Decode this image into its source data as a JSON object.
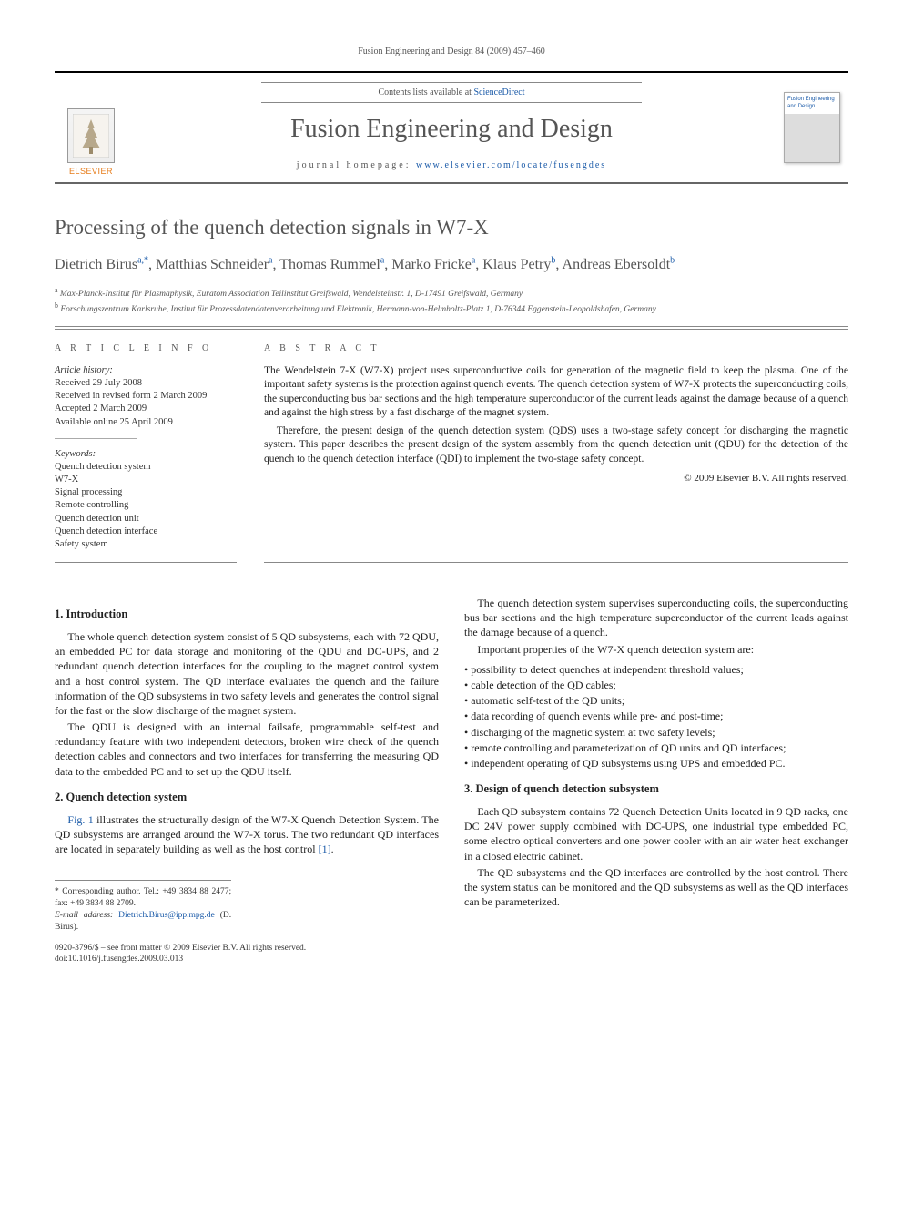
{
  "running_head": "Fusion Engineering and Design 84 (2009) 457–460",
  "masthead": {
    "contents_prefix": "Contents lists available at ",
    "contents_link": "ScienceDirect",
    "journal_title": "Fusion Engineering and Design",
    "homepage_prefix": "journal homepage: ",
    "homepage_link": "www.elsevier.com/locate/fusengdes",
    "publisher": "ELSEVIER",
    "cover_label": "Fusion Engineering and Design"
  },
  "article": {
    "title": "Processing of the quench detection signals in W7-X",
    "authors_html": "Dietrich Birus<sup>a,*</sup>, Matthias Schneider<sup>a</sup>, Thomas Rummel<sup>a</sup>, Marko Fricke<sup>a</sup>, Klaus Petry<sup>b</sup>, Andreas Ebersoldt<sup>b</sup>",
    "affiliations": [
      "a Max-Planck-Institut für Plasmaphysik, Euratom Association Teilinstitut Greifswald, Wendelsteinstr. 1, D-17491 Greifswald, Germany",
      "b Forschungszentrum Karlsruhe, Institut für Prozessdatendatenverarbeitung und Elektronik, Hermann-von-Helmholtz-Platz 1, D-76344 Eggenstein-Leopoldshafen, Germany"
    ]
  },
  "info": {
    "head": "A R T I C L E   I N F O",
    "history_label": "Article history:",
    "history": [
      "Received 29 July 2008",
      "Received in revised form 2 March 2009",
      "Accepted 2 March 2009",
      "Available online 25 April 2009"
    ],
    "keywords_label": "Keywords:",
    "keywords": [
      "Quench detection system",
      "W7-X",
      "Signal processing",
      "Remote controlling",
      "Quench detection unit",
      "Quench detection interface",
      "Safety system"
    ]
  },
  "abstract": {
    "head": "A B S T R A C T",
    "p1": "The Wendelstein 7-X (W7-X) project uses superconductive coils for generation of the magnetic field to keep the plasma. One of the important safety systems is the protection against quench events. The quench detection system of W7-X protects the superconducting coils, the superconducting bus bar sections and the high temperature superconductor of the current leads against the damage because of a quench and against the high stress by a fast discharge of the magnet system.",
    "p2": "Therefore, the present design of the quench detection system (QDS) uses a two-stage safety concept for discharging the magnetic system. This paper describes the present design of the system assembly from the quench detection unit (QDU) for the detection of the quench to the quench detection interface (QDI) to implement the two-stage safety concept.",
    "copyright": "© 2009 Elsevier B.V. All rights reserved."
  },
  "sections": {
    "s1": {
      "head": "1.  Introduction",
      "p1": "The whole quench detection system consist of 5 QD subsystems, each with 72 QDU, an embedded PC for data storage and monitoring of the QDU and DC-UPS, and 2 redundant quench detection interfaces for the coupling to the magnet control system and a host control system. The QD interface evaluates the quench and the failure information of the QD subsystems in two safety levels and generates the control signal for the fast or the slow discharge of the magnet system.",
      "p2": "The QDU is designed with an internal failsafe, programmable self-test and redundancy feature with two independent detectors, broken wire check of the quench detection cables and connectors and two interfaces for transferring the measuring QD data to the embedded PC and to set up the QDU itself."
    },
    "s2": {
      "head": "2.  Quench detection system",
      "p1a": "",
      "figref": "Fig. 1",
      "p1b": " illustrates the structurally design of the W7-X Quench Detection System. The QD subsystems are arranged around the W7-X torus. The two redundant QD interfaces are located in separately building as well as the host control ",
      "citeref": "[1]",
      "p1c": ".",
      "p2": "The quench detection system supervises superconducting coils, the superconducting bus bar sections and the high temperature superconductor of the current leads against the damage because of a quench.",
      "p3": "Important properties of the W7-X quench detection system are:",
      "bullets": [
        "possibility to detect quenches at independent threshold values;",
        "cable detection of the QD cables;",
        "automatic self-test of the QD units;",
        "data recording of quench events while pre- and post-time;",
        "discharging of the magnetic system at two safety levels;",
        "remote controlling and parameterization of QD units and QD interfaces;",
        "independent operating of QD subsystems using UPS and embedded PC."
      ]
    },
    "s3": {
      "head": "3.  Design of quench detection subsystem",
      "p1": "Each QD subsystem contains 72 Quench Detection Units located in 9 QD racks, one DC 24V power supply combined with DC-UPS, one industrial type embedded PC, some electro optical converters and one power cooler with an air water heat exchanger in a closed electric cabinet.",
      "p2": "The QD subsystems and the QD interfaces are controlled by the host control. There the system status can be monitored and the QD subsystems as well as the QD interfaces can be parameterized."
    }
  },
  "footnote": {
    "corr": "* Corresponding author. Tel.: +49 3834 88 2477; fax: +49 3834 88 2709.",
    "email_label": "E-mail address: ",
    "email": "Dietrich.Birus@ipp.mpg.de",
    "email_suffix": " (D. Birus)."
  },
  "fineprint": {
    "line1": "0920-3796/$ – see front matter © 2009 Elsevier B.V. All rights reserved.",
    "line2": "doi:10.1016/j.fusengdes.2009.03.013"
  }
}
